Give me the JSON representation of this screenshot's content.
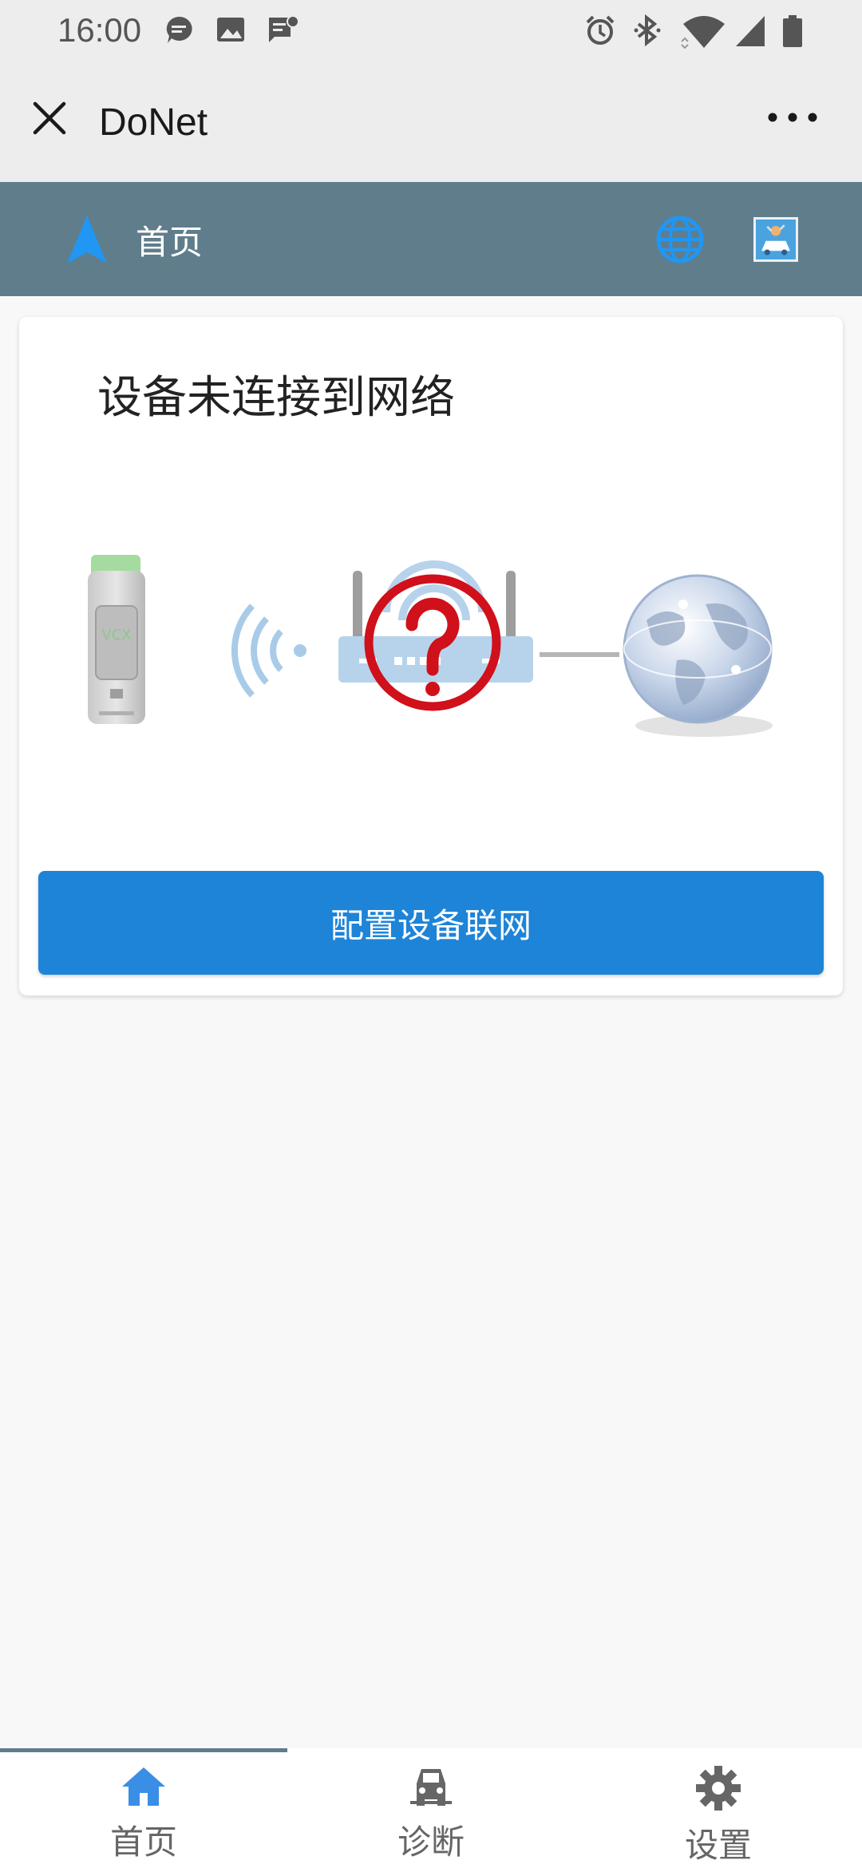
{
  "status_bar": {
    "time": "16:00",
    "left_icons": [
      "chat-bubble-icon",
      "image-icon",
      "message-icon"
    ],
    "right_icons": [
      "alarm-icon",
      "bluetooth-icon",
      "wifi-icon",
      "signal-icon",
      "battery-icon"
    ]
  },
  "title_bar": {
    "app_name": "DoNet"
  },
  "header": {
    "title": "首页"
  },
  "card": {
    "heading": "设备未连接到网络",
    "device_label": "VCX",
    "button_label": "配置设备联网"
  },
  "tabs": [
    {
      "label": "首页",
      "icon": "home-icon",
      "active": true
    },
    {
      "label": "诊断",
      "icon": "car-icon",
      "active": false
    },
    {
      "label": "设置",
      "icon": "gear-icon",
      "active": false
    }
  ],
  "colors": {
    "header_bg": "#607d8b",
    "accent_blue": "#1e84d8",
    "error_red": "#d0101a",
    "active_tab": "#3a8ee6"
  }
}
